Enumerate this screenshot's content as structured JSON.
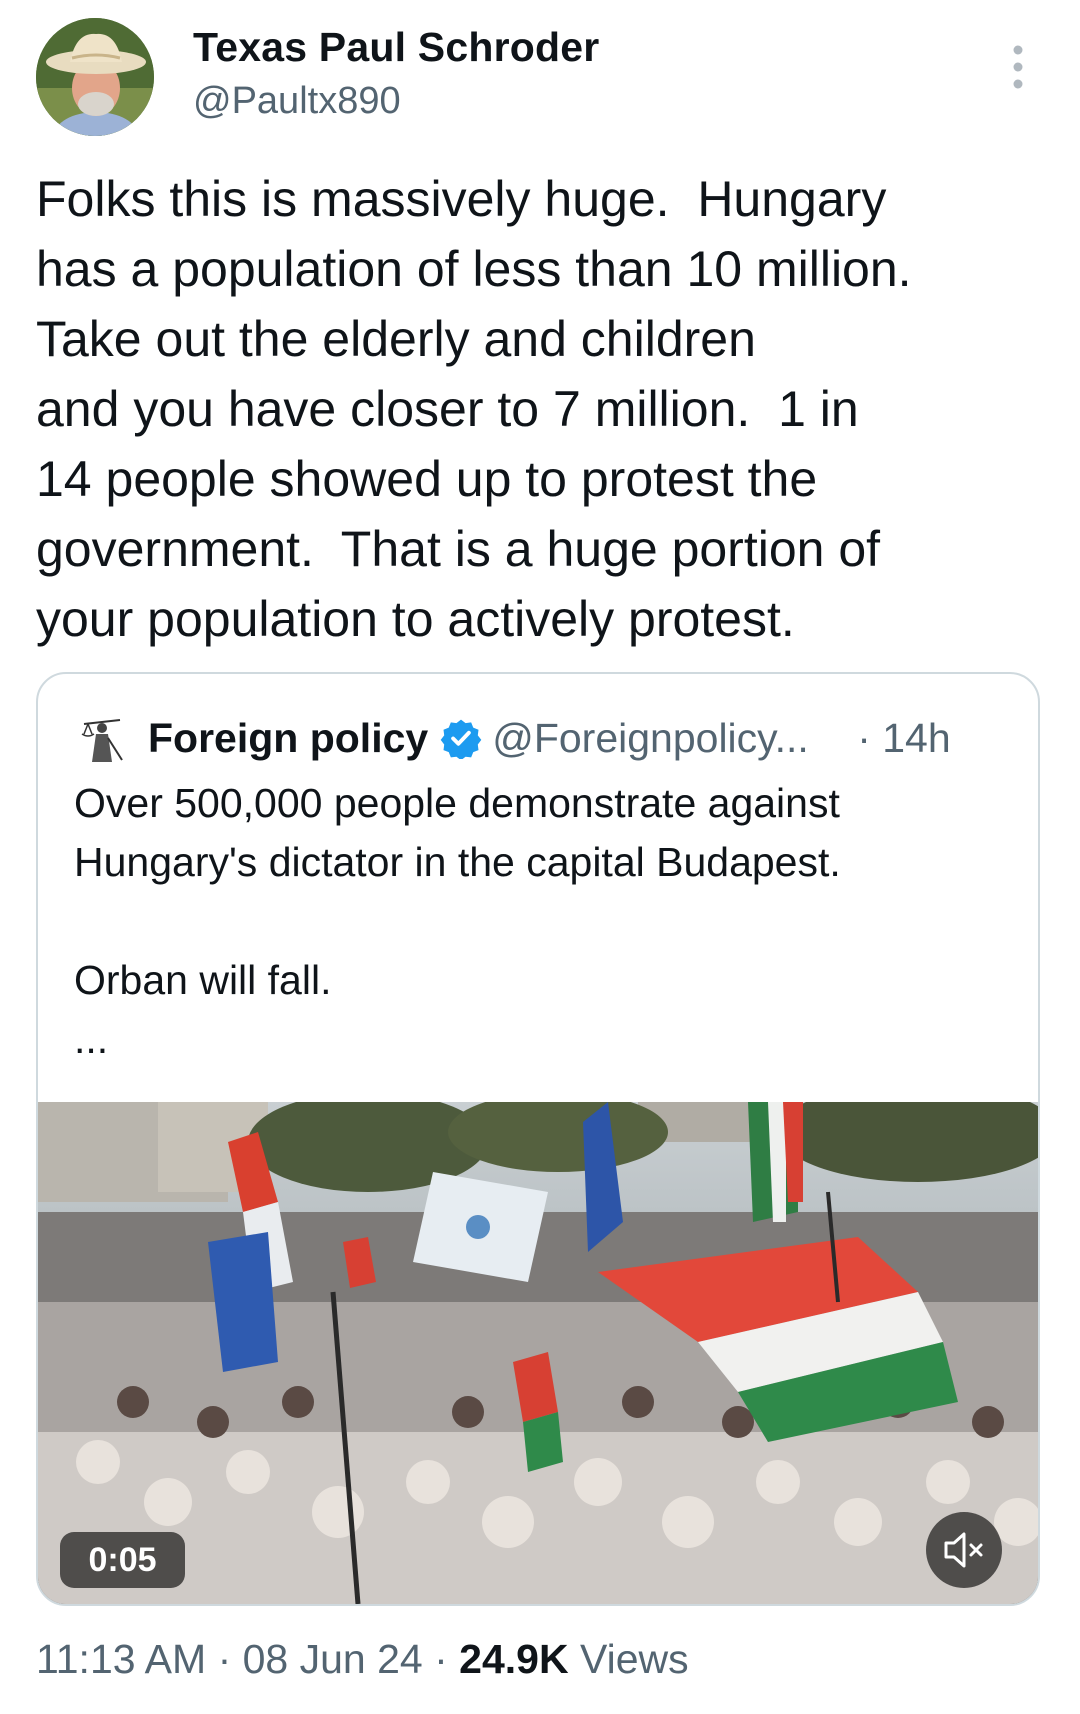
{
  "author": {
    "display_name": "Texas Paul Schroder",
    "handle": "@Paultx890",
    "avatar_icon": "cowboy-hat-man-avatar"
  },
  "tweet": {
    "lines": [
      "Folks this is massively huge.  Hungary",
      "has a population of less than 10 million.",
      "Take out the elderly and children",
      "and you have closer to 7 million.  1 in",
      "14 people showed up to protest the",
      "government.  That is a huge portion of",
      "your population to actively protest."
    ]
  },
  "quote": {
    "logo_icon": "lady-justice-logo",
    "name": "Foreign policy",
    "verified_icon": "verified-badge-icon",
    "handle": "@Foreignpolicy...",
    "time": "· 14h",
    "text_lines": [
      "Over 500,000 people demonstrate against",
      "Hungary's dictator in the capital Budapest."
    ],
    "text_line_3": "Orban will fall.",
    "ellipsis": "...",
    "video": {
      "duration": "0:05",
      "mute_icon": "speaker-muted-icon"
    }
  },
  "meta": {
    "time": "11:13 AM",
    "sep1": " · ",
    "date": "08 Jun 24",
    "sep2": " · ",
    "views_count": "24.9K",
    "views_label": " Views"
  },
  "colors": {
    "text": "#0f1419",
    "secondary": "#536471",
    "border": "#cfd9de",
    "verified": "#1d9bf0"
  }
}
